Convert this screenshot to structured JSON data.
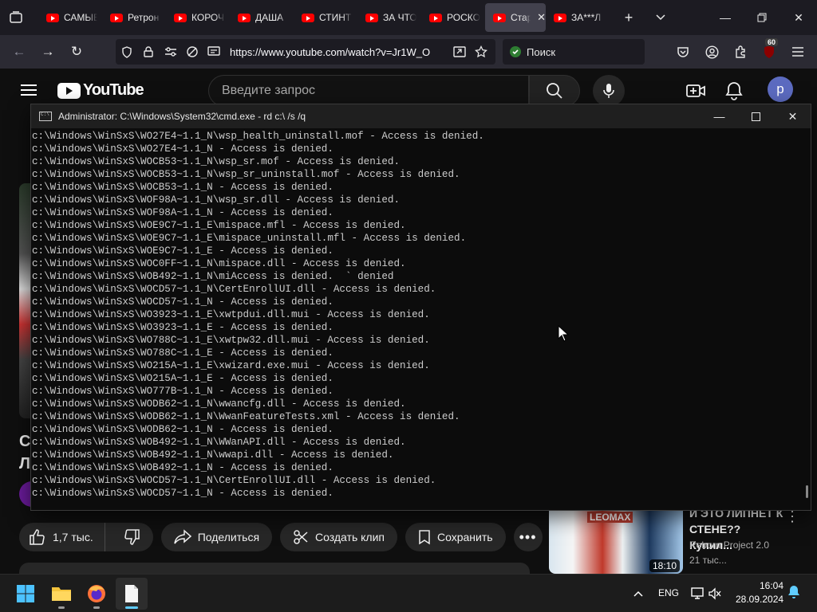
{
  "browser": {
    "tabs": [
      {
        "label": "САМЫЕ"
      },
      {
        "label": "Ретрон"
      },
      {
        "label": "КОРОЧ"
      },
      {
        "label": "ДАША"
      },
      {
        "label": "СТИНТ"
      },
      {
        "label": "ЗА ЧТО"
      },
      {
        "label": "РОСКО"
      },
      {
        "label": "Стар",
        "active": true
      },
      {
        "label": "ЗА***Л"
      }
    ],
    "url": "https://www.youtube.com/watch?v=Jr1W_O",
    "search_placeholder": "Поиск",
    "extension_badge": "60"
  },
  "youtube": {
    "logo_text": "YouTube",
    "search_placeholder": "Введите запрос",
    "avatar_letter": "p",
    "title_peek_lines": [
      "С",
      "Л"
    ],
    "actions": {
      "likes": "1,7 тыс.",
      "share": "Поделиться",
      "clip": "Создать клип",
      "save": "Сохранить"
    },
    "recommendation": {
      "title": "И ЭТО ЛИПНЕТ К СТЕНЕ?? Купил...",
      "channel": "Reborn Project 2.0",
      "views": "21 тыс...",
      "duration": "18:10",
      "thumb_text": "LEOMAX"
    }
  },
  "console": {
    "title": "Administrator: C:\\Windows\\System32\\cmd.exe - rd  c:\\ /s /q",
    "lines": [
      "c:\\Windows\\WinSxS\\WO27E4~1.1_N\\wsp_health_uninstall.mof - Access is denied.",
      "c:\\Windows\\WinSxS\\WO27E4~1.1_N - Access is denied.",
      "c:\\Windows\\WinSxS\\WOCB53~1.1_N\\wsp_sr.mof - Access is denied.",
      "c:\\Windows\\WinSxS\\WOCB53~1.1_N\\wsp_sr_uninstall.mof - Access is denied.",
      "c:\\Windows\\WinSxS\\WOCB53~1.1_N - Access is denied.",
      "c:\\Windows\\WinSxS\\WOF98A~1.1_N\\wsp_sr.dll - Access is denied.",
      "c:\\Windows\\WinSxS\\WOF98A~1.1_N - Access is denied.",
      "c:\\Windows\\WinSxS\\WOE9C7~1.1_E\\mispace.mfl - Access is denied.",
      "c:\\Windows\\WinSxS\\WOE9C7~1.1_E\\mispace_uninstall.mfl - Access is denied.",
      "c:\\Windows\\WinSxS\\WOE9C7~1.1_E - Access is denied.",
      "c:\\Windows\\WinSxS\\WOC0FF~1.1_N\\mispace.dll - Access is denied.",
      "c:\\Windows\\WinSxS\\WOB492~1.1_N\\miAccess is denied.  ` denied",
      "c:\\Windows\\WinSxS\\WOCD57~1.1_N\\CertEnrollUI.dll - Access is denied.",
      "c:\\Windows\\WinSxS\\WOCD57~1.1_N - Access is denied.",
      "c:\\Windows\\WinSxS\\WO3923~1.1_E\\xwtpdui.dll.mui - Access is denied.",
      "c:\\Windows\\WinSxS\\WO3923~1.1_E - Access is denied.",
      "c:\\Windows\\WinSxS\\WO788C~1.1_E\\xwtpw32.dll.mui - Access is denied.",
      "c:\\Windows\\WinSxS\\WO788C~1.1_E - Access is denied.",
      "c:\\Windows\\WinSxS\\WO215A~1.1_E\\xwizard.exe.mui - Access is denied.",
      "c:\\Windows\\WinSxS\\WO215A~1.1_E - Access is denied.",
      "c:\\Windows\\WinSxS\\WO777B~1.1_N - Access is denied.",
      "c:\\Windows\\WinSxS\\WODB62~1.1_N\\wwancfg.dll - Access is denied.",
      "c:\\Windows\\WinSxS\\WODB62~1.1_N\\WwanFeatureTests.xml - Access is denied.",
      "c:\\Windows\\WinSxS\\WODB62~1.1_N - Access is denied.",
      "c:\\Windows\\WinSxS\\WOB492~1.1_N\\WWanAPI.dll - Access is denied.",
      "c:\\Windows\\WinSxS\\WOB492~1.1_N\\wwapi.dll - Access is denied.",
      "c:\\Windows\\WinSxS\\WOB492~1.1_N - Access is denied.",
      "c:\\Windows\\WinSxS\\WOCD57~1.1_N\\CertEnrollUI.dll - Access is denied.",
      "c:\\Windows\\WinSxS\\WOCD57~1.1_N - Access is denied."
    ]
  },
  "taskbar": {
    "language": "ENG",
    "time": "16:04",
    "date": "28.09.2024"
  },
  "colors": {
    "console_bg": "#0c0c0c",
    "console_text": "#cccccc",
    "youtube_bg": "#0f0f0f",
    "accent_red": "#ff0000",
    "taskbar_active": "#60cdff"
  }
}
